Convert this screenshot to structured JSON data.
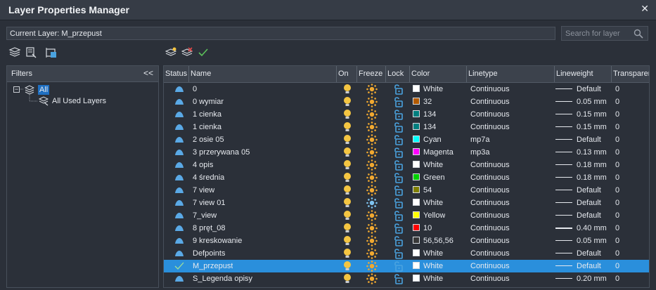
{
  "window": {
    "title": "Layer Properties Manager",
    "close_glyph": "✕"
  },
  "current_layer": {
    "text": "Current Layer: M_przepust"
  },
  "search": {
    "placeholder": "Search for layer"
  },
  "filters": {
    "header": "Filters",
    "collapse_glyph": "<<",
    "expander_glyph": "−",
    "all_label": "All",
    "used_label": "All Used Layers"
  },
  "columns": {
    "status": "Status",
    "name": "Name",
    "on": "On",
    "freeze": "Freeze",
    "lock": "Lock",
    "color": "Color",
    "linetype": "Linetype",
    "lineweight": "Lineweight",
    "transparency": "Transparer"
  },
  "colors": {
    "selection": "#2a8fdc",
    "bulb": "#f4c542",
    "sun": "#f0a830",
    "lock": "#4aa3e0"
  },
  "rows": [
    {
      "name": "0",
      "color_name": "White",
      "swatch": "#ffffff",
      "linetype": "Continuous",
      "lineweight": "Default",
      "transparency": "0",
      "selected": false,
      "frozen": false
    },
    {
      "name": "0 wymiar",
      "color_name": "32",
      "swatch": "#b35a00",
      "linetype": "Continuous",
      "lineweight": "0.05 mm",
      "transparency": "0",
      "selected": false,
      "frozen": false
    },
    {
      "name": "1  cienka",
      "color_name": "134",
      "swatch": "#007f7f",
      "linetype": "Continuous",
      "lineweight": "0.15 mm",
      "transparency": "0",
      "selected": false,
      "frozen": false
    },
    {
      "name": "1 cienka",
      "color_name": "134",
      "swatch": "#007f7f",
      "linetype": "Continuous",
      "lineweight": "0.15 mm",
      "transparency": "0",
      "selected": false,
      "frozen": false
    },
    {
      "name": "2 osie 05",
      "color_name": "Cyan",
      "swatch": "#00ffff",
      "linetype": "mp7a",
      "lineweight": "Default",
      "transparency": "0",
      "selected": false,
      "frozen": false
    },
    {
      "name": "3 przerywana 05",
      "color_name": "Magenta",
      "swatch": "#ff00ff",
      "linetype": "mp3a",
      "lineweight": "0.13 mm",
      "transparency": "0",
      "selected": false,
      "frozen": false
    },
    {
      "name": "4 opis",
      "color_name": "White",
      "swatch": "#ffffff",
      "linetype": "Continuous",
      "lineweight": "0.18 mm",
      "transparency": "0",
      "selected": false,
      "frozen": false
    },
    {
      "name": "4 średnia",
      "color_name": "Green",
      "swatch": "#00d000",
      "linetype": "Continuous",
      "lineweight": "0.18 mm",
      "transparency": "0",
      "selected": false,
      "frozen": false
    },
    {
      "name": "7 view",
      "color_name": "54",
      "swatch": "#7f7f00",
      "linetype": "Continuous",
      "lineweight": "Default",
      "transparency": "0",
      "selected": false,
      "frozen": false
    },
    {
      "name": "7 view 01",
      "color_name": "White",
      "swatch": "#ffffff",
      "linetype": "Continuous",
      "lineweight": "Default",
      "transparency": "0",
      "selected": false,
      "frozen": true
    },
    {
      "name": "7_view",
      "color_name": "Yellow",
      "swatch": "#ffff00",
      "linetype": "Continuous",
      "lineweight": "Default",
      "transparency": "0",
      "selected": false,
      "frozen": false
    },
    {
      "name": "8 pręt_08",
      "color_name": "10",
      "swatch": "#ff0000",
      "linetype": "Continuous",
      "lineweight": "0.40 mm",
      "transparency": "0",
      "selected": false,
      "frozen": false
    },
    {
      "name": "9 kreskowanie",
      "color_name": "56,56,56",
      "swatch": "#383838",
      "linetype": "Continuous",
      "lineweight": "0.05 mm",
      "transparency": "0",
      "selected": false,
      "frozen": false
    },
    {
      "name": "Defpoints",
      "color_name": "White",
      "swatch": "#ffffff",
      "linetype": "Continuous",
      "lineweight": "Default",
      "transparency": "0",
      "selected": false,
      "frozen": false
    },
    {
      "name": "M_przepust",
      "color_name": "White",
      "swatch": "#ffffff",
      "linetype": "Continuous",
      "lineweight": "Default",
      "transparency": "0",
      "selected": true,
      "frozen": false
    },
    {
      "name": "S_Legenda opisy",
      "color_name": "White",
      "swatch": "#ffffff",
      "linetype": "Continuous",
      "lineweight": "0.20 mm",
      "transparency": "0",
      "selected": false,
      "frozen": false
    }
  ]
}
